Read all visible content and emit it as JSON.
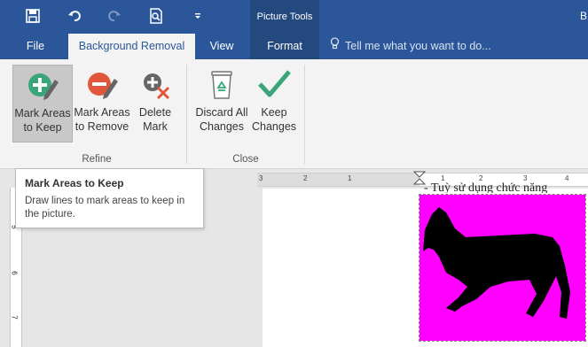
{
  "title_bar": {
    "picture_tools": "Picture Tools",
    "right_fragment": "B"
  },
  "tabs": {
    "file": "File",
    "background_removal": "Background Removal",
    "view": "View",
    "format": "Format",
    "tell_me": "Tell me what you want to do..."
  },
  "ribbon": {
    "mark_keep": [
      "Mark Areas",
      "to Keep"
    ],
    "mark_remove": [
      "Mark Areas",
      "to Remove"
    ],
    "delete_mark": [
      "Delete",
      "Mark"
    ],
    "discard": [
      "Discard All",
      "Changes"
    ],
    "keep": [
      "Keep",
      "Changes"
    ],
    "group_refine": "Refine",
    "group_close": "Close"
  },
  "tooltip": {
    "title": "Mark Areas to Keep",
    "body": "Draw lines to mark areas to keep in the picture."
  },
  "ruler": {
    "h_numbers": [
      "3",
      "2",
      "1",
      "1",
      "2",
      "3",
      "4"
    ],
    "v_numbers": [
      "5",
      "6",
      "7"
    ]
  },
  "document": {
    "partial_text": "- Tuỳ sử dụng chức năng"
  },
  "colors": {
    "accent": "#2b579a",
    "picture_bg": "#ff00ff",
    "remove_red": "#e2573c",
    "keep_green": "#3aa57a"
  }
}
